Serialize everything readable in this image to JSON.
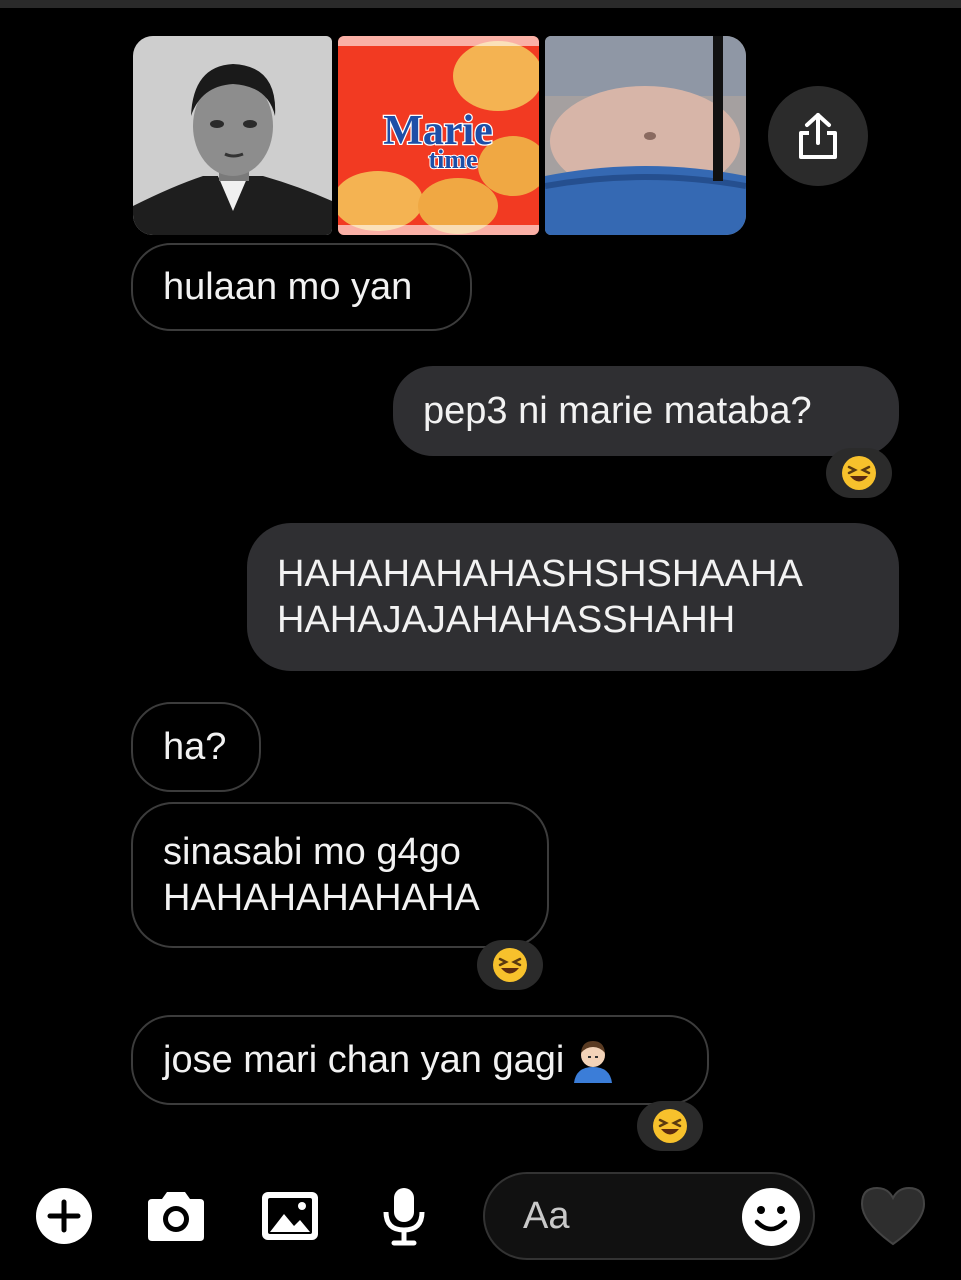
{
  "images": {
    "photo1": "portrait-photo",
    "photo2": {
      "brand_line1": "Marie",
      "brand_line2": "time"
    },
    "photo3": "belly-photo"
  },
  "messages": [
    {
      "side": "in",
      "text": "hulaan mo yan"
    },
    {
      "side": "out",
      "text": "pep3 ni marie mataba?",
      "reaction": "laughing-face-emoji"
    },
    {
      "side": "out",
      "text": "HAHAHAHAHASHSHSHAAHA\nHAHAJAJAHAHASSHAHH"
    },
    {
      "side": "in",
      "text": "ha?"
    },
    {
      "side": "in",
      "text": "sinasabi mo g4go\nHAHAHAHAHAHA",
      "reaction": "laughing-face-emoji"
    },
    {
      "side": "in",
      "text": "jose mari chan yan gagi",
      "emoji": "man-emoji",
      "reaction": "laughing-face-emoji"
    }
  ],
  "composer": {
    "placeholder": "Aa",
    "icons": [
      "plus-icon",
      "camera-icon",
      "image-icon",
      "microphone-icon",
      "smiley-icon",
      "heart-icon"
    ]
  },
  "colors": {
    "background": "#000000",
    "incoming_border": "#3c3c3c",
    "outgoing_bubble": "#2f2f32",
    "text": "#f2f2f2"
  }
}
